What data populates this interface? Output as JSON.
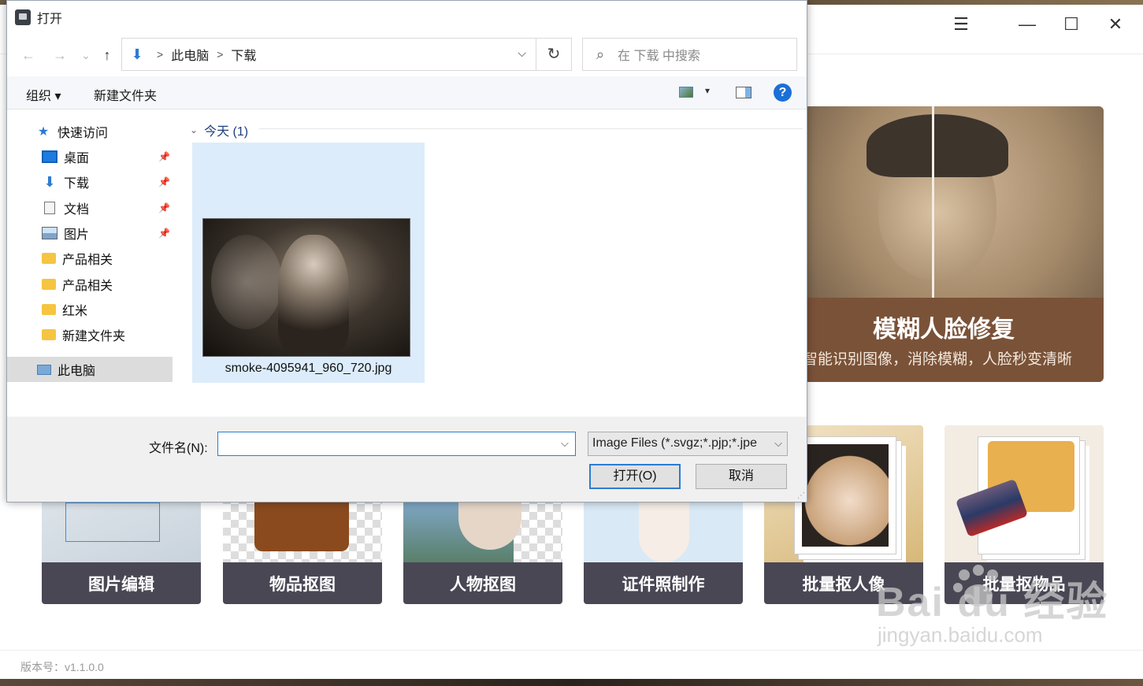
{
  "app": {
    "win_controls": {
      "menu": "☰",
      "minimize": "—",
      "maximize": "☐",
      "close": "✕"
    },
    "hero": {
      "title": "模糊人脸修复",
      "subtitle": "智能识别图像，消除模糊，人脸秒变清晰"
    },
    "cards": [
      {
        "label": "图片编辑"
      },
      {
        "label": "物品抠图"
      },
      {
        "label": "人物抠图"
      },
      {
        "label": "证件照制作"
      },
      {
        "label": "批量抠人像"
      },
      {
        "label": "批量抠物品"
      }
    ],
    "version": "版本号：v1.1.0.0"
  },
  "watermark": {
    "line1": "Bai du 经验",
    "line2": "jingyan.baidu.com"
  },
  "dialog": {
    "title": "打开",
    "nav": {
      "back": "←",
      "forward": "→",
      "recent": "⌄",
      "up": "↑"
    },
    "address": {
      "download_icon": "⬇",
      "sep": ">",
      "crumbs": [
        "此电脑",
        "下载"
      ],
      "dropdown": "⌵"
    },
    "refresh": "↻",
    "search": {
      "icon": "⌕",
      "placeholder": "在 下载 中搜索"
    },
    "toolbar": {
      "organize": "组织 ▾",
      "new_folder": "新建文件夹",
      "help": "?",
      "view_dropdown": "▾"
    },
    "sidebar": {
      "quick_access": "快速访问",
      "items": [
        {
          "label": "桌面",
          "icon": "desktop-icon",
          "pinned": true
        },
        {
          "label": "下载",
          "icon": "download-icon",
          "pinned": true
        },
        {
          "label": "文档",
          "icon": "document-icon",
          "pinned": true
        },
        {
          "label": "图片",
          "icon": "picture-icon",
          "pinned": true
        },
        {
          "label": "产品相关",
          "icon": "folder-icon",
          "pinned": false
        },
        {
          "label": "产品相关",
          "icon": "folder-icon",
          "pinned": false
        },
        {
          "label": "红米",
          "icon": "folder-icon",
          "pinned": false
        },
        {
          "label": "新建文件夹",
          "icon": "folder-icon",
          "pinned": false
        }
      ],
      "this_pc": "此电脑",
      "pin_glyph": "📌"
    },
    "content": {
      "group_chevron": "⌄",
      "group": "今天 (1)",
      "files": [
        {
          "name": "smoke-4095941_960_720.jpg"
        }
      ]
    },
    "bottom": {
      "filename_label": "文件名(N):",
      "filename_value": "",
      "filetype": "Image Files (*.svgz;*.pjp;*.jpe",
      "open": "打开(O)",
      "cancel": "取消",
      "dropdown": "⌵"
    }
  }
}
